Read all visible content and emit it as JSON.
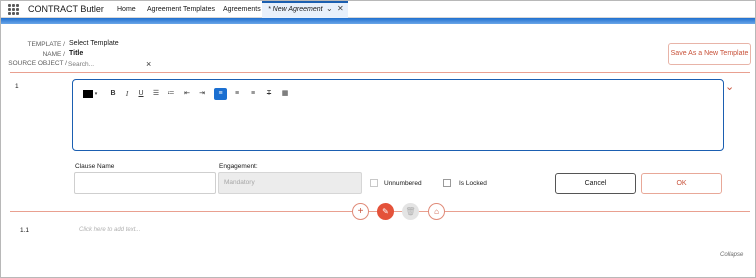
{
  "app": {
    "name": "CONTRACT Butler"
  },
  "nav": {
    "items": [
      "Home",
      "Agreement Templates",
      "Agreements"
    ],
    "active_tab": "* New Agreement"
  },
  "header": {
    "template_key": "TEMPLATE /",
    "template_value": "Select Template",
    "name_key": "NAME /",
    "name_value": "Title",
    "source_key": "SOURCE OBJECT /",
    "source_placeholder": "Search...",
    "save_as_label": "Save As a New Template"
  },
  "clause": {
    "number": "1",
    "clause_name_label": "Clause Name",
    "engagement_label": "Engagement:",
    "engagement_placeholder": "Mandatory",
    "unnumbered_label": "Unnumbered",
    "locked_label": "Is Locked",
    "cancel_label": "Cancel",
    "ok_label": "OK"
  },
  "toolbar": {
    "color_name": "text-color-icon",
    "bold": "B",
    "italic": "I",
    "underline": "U"
  },
  "subclause": {
    "number": "1.1",
    "placeholder": "Click here to add text..."
  },
  "footer": {
    "collapse_label": "Collapse"
  },
  "colors": {
    "accent": "#c8523a",
    "brand_blue": "#1b5fb1",
    "active_blue": "#1b6fd1"
  }
}
